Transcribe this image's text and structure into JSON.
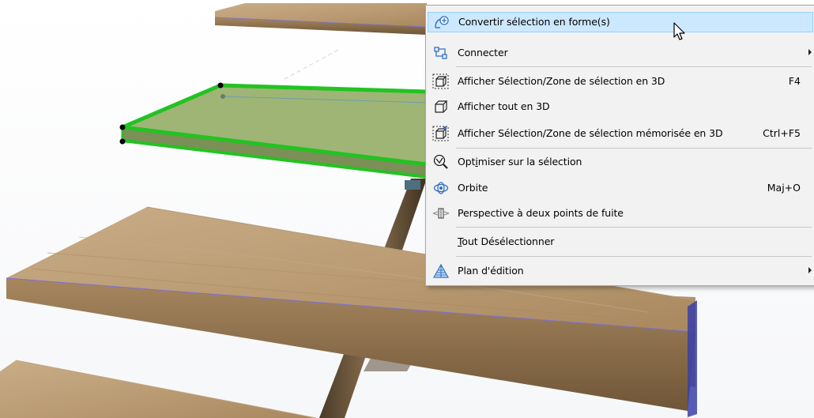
{
  "context_menu": {
    "items": [
      {
        "label": "Convertir sélection en forme(s)",
        "icon": "convert-to-shape-icon",
        "shortcut": "",
        "has_submenu": false,
        "highlighted": true
      },
      {
        "label": "Connecter",
        "icon": "connect-icon",
        "shortcut": "",
        "has_submenu": true,
        "highlighted": false
      },
      {
        "label": "Afficher Sélection/Zone de sélection en 3D",
        "icon": "show-selection-3d-icon",
        "shortcut": "F4",
        "has_submenu": false,
        "highlighted": false
      },
      {
        "label": "Afficher tout en 3D",
        "icon": "show-all-3d-icon",
        "shortcut": "",
        "has_submenu": false,
        "highlighted": false
      },
      {
        "label": "Afficher Sélection/Zone de sélection mémorisée en 3D",
        "icon": "show-stored-selection-3d-icon",
        "shortcut": "Ctrl+F5",
        "has_submenu": false,
        "highlighted": false
      },
      {
        "label_pre": "Opt",
        "label_u": "i",
        "label_post": "miser sur la sélection",
        "icon": "zoom-to-selection-icon",
        "shortcut": "",
        "has_submenu": false,
        "highlighted": false
      },
      {
        "label": "Orbite",
        "icon": "orbit-icon",
        "shortcut": "Maj+O",
        "has_submenu": false,
        "highlighted": false
      },
      {
        "label": "Perspective à deux points de fuite",
        "icon": "two-point-perspective-icon",
        "shortcut": "",
        "has_submenu": false,
        "highlighted": false
      },
      {
        "label_pre": "",
        "label_u": "T",
        "label_post": "out Désélectionner",
        "icon": "",
        "shortcut": "",
        "has_submenu": false,
        "highlighted": false
      },
      {
        "label": "Plan d'édition",
        "icon": "editing-plane-icon",
        "shortcut": "",
        "has_submenu": true,
        "highlighted": false
      }
    ]
  },
  "colors": {
    "highlight_bg": "#cce8ff",
    "highlight_border": "#99d1ff",
    "selection_green": "#22cc22",
    "wood": "#b89a72",
    "menu_bg": "#f2f2f2"
  }
}
